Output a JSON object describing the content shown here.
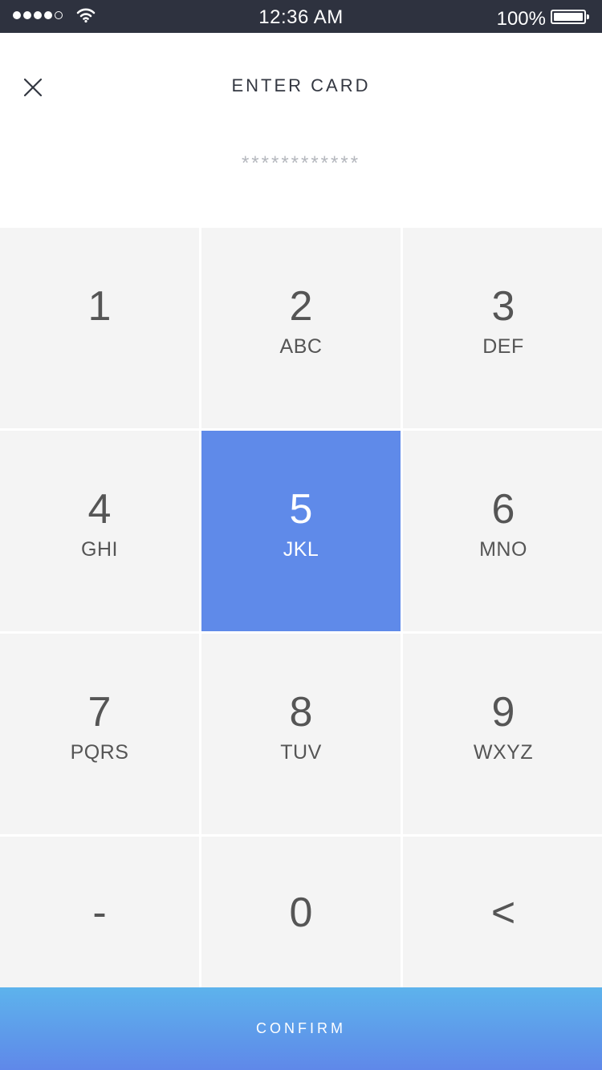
{
  "status_bar": {
    "time": "12:36 AM",
    "battery": "100%",
    "signal_bars_filled": 4,
    "signal_bars_total": 5,
    "battery_level": 1.0
  },
  "header": {
    "close_icon": "close-icon",
    "title": "ENTER CARD",
    "masked_value": "************"
  },
  "keypad": {
    "keys": [
      {
        "digit": "1",
        "letters": ""
      },
      {
        "digit": "2",
        "letters": "ABC"
      },
      {
        "digit": "3",
        "letters": "DEF"
      },
      {
        "digit": "4",
        "letters": "GHI"
      },
      {
        "digit": "5",
        "letters": "JKL",
        "active": true
      },
      {
        "digit": "6",
        "letters": "MNO"
      },
      {
        "digit": "7",
        "letters": "PQRS"
      },
      {
        "digit": "8",
        "letters": "TUV"
      },
      {
        "digit": "9",
        "letters": "WXYZ"
      },
      {
        "digit": "-",
        "letters": ""
      },
      {
        "digit": "0",
        "letters": ""
      },
      {
        "digit": "<",
        "letters": ""
      }
    ],
    "active_color": "#5f8ae9"
  },
  "confirm": {
    "label": "CONFIRM"
  }
}
